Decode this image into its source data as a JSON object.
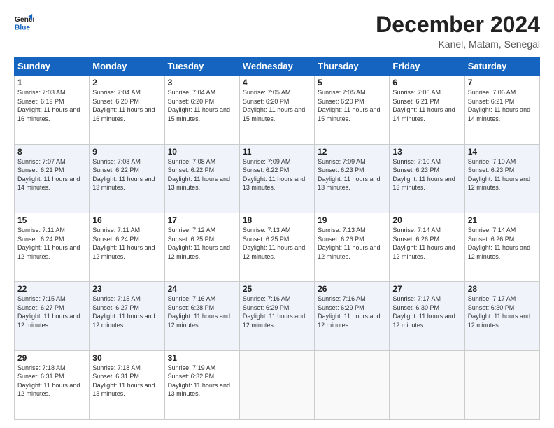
{
  "logo": {
    "line1": "General",
    "line2": "Blue"
  },
  "header": {
    "month_year": "December 2024",
    "location": "Kanel, Matam, Senegal"
  },
  "days_of_week": [
    "Sunday",
    "Monday",
    "Tuesday",
    "Wednesday",
    "Thursday",
    "Friday",
    "Saturday"
  ],
  "weeks": [
    [
      {
        "day": 1,
        "sunrise": "7:03 AM",
        "sunset": "6:19 PM",
        "daylight": "11 hours and 16 minutes."
      },
      {
        "day": 2,
        "sunrise": "7:04 AM",
        "sunset": "6:20 PM",
        "daylight": "11 hours and 16 minutes."
      },
      {
        "day": 3,
        "sunrise": "7:04 AM",
        "sunset": "6:20 PM",
        "daylight": "11 hours and 15 minutes."
      },
      {
        "day": 4,
        "sunrise": "7:05 AM",
        "sunset": "6:20 PM",
        "daylight": "11 hours and 15 minutes."
      },
      {
        "day": 5,
        "sunrise": "7:05 AM",
        "sunset": "6:20 PM",
        "daylight": "11 hours and 15 minutes."
      },
      {
        "day": 6,
        "sunrise": "7:06 AM",
        "sunset": "6:21 PM",
        "daylight": "11 hours and 14 minutes."
      },
      {
        "day": 7,
        "sunrise": "7:06 AM",
        "sunset": "6:21 PM",
        "daylight": "11 hours and 14 minutes."
      }
    ],
    [
      {
        "day": 8,
        "sunrise": "7:07 AM",
        "sunset": "6:21 PM",
        "daylight": "11 hours and 14 minutes."
      },
      {
        "day": 9,
        "sunrise": "7:08 AM",
        "sunset": "6:22 PM",
        "daylight": "11 hours and 13 minutes."
      },
      {
        "day": 10,
        "sunrise": "7:08 AM",
        "sunset": "6:22 PM",
        "daylight": "11 hours and 13 minutes."
      },
      {
        "day": 11,
        "sunrise": "7:09 AM",
        "sunset": "6:22 PM",
        "daylight": "11 hours and 13 minutes."
      },
      {
        "day": 12,
        "sunrise": "7:09 AM",
        "sunset": "6:23 PM",
        "daylight": "11 hours and 13 minutes."
      },
      {
        "day": 13,
        "sunrise": "7:10 AM",
        "sunset": "6:23 PM",
        "daylight": "11 hours and 13 minutes."
      },
      {
        "day": 14,
        "sunrise": "7:10 AM",
        "sunset": "6:23 PM",
        "daylight": "11 hours and 12 minutes."
      }
    ],
    [
      {
        "day": 15,
        "sunrise": "7:11 AM",
        "sunset": "6:24 PM",
        "daylight": "11 hours and 12 minutes."
      },
      {
        "day": 16,
        "sunrise": "7:11 AM",
        "sunset": "6:24 PM",
        "daylight": "11 hours and 12 minutes."
      },
      {
        "day": 17,
        "sunrise": "7:12 AM",
        "sunset": "6:25 PM",
        "daylight": "11 hours and 12 minutes."
      },
      {
        "day": 18,
        "sunrise": "7:13 AM",
        "sunset": "6:25 PM",
        "daylight": "11 hours and 12 minutes."
      },
      {
        "day": 19,
        "sunrise": "7:13 AM",
        "sunset": "6:26 PM",
        "daylight": "11 hours and 12 minutes."
      },
      {
        "day": 20,
        "sunrise": "7:14 AM",
        "sunset": "6:26 PM",
        "daylight": "11 hours and 12 minutes."
      },
      {
        "day": 21,
        "sunrise": "7:14 AM",
        "sunset": "6:26 PM",
        "daylight": "11 hours and 12 minutes."
      }
    ],
    [
      {
        "day": 22,
        "sunrise": "7:15 AM",
        "sunset": "6:27 PM",
        "daylight": "11 hours and 12 minutes."
      },
      {
        "day": 23,
        "sunrise": "7:15 AM",
        "sunset": "6:27 PM",
        "daylight": "11 hours and 12 minutes."
      },
      {
        "day": 24,
        "sunrise": "7:16 AM",
        "sunset": "6:28 PM",
        "daylight": "11 hours and 12 minutes."
      },
      {
        "day": 25,
        "sunrise": "7:16 AM",
        "sunset": "6:29 PM",
        "daylight": "11 hours and 12 minutes."
      },
      {
        "day": 26,
        "sunrise": "7:16 AM",
        "sunset": "6:29 PM",
        "daylight": "11 hours and 12 minutes."
      },
      {
        "day": 27,
        "sunrise": "7:17 AM",
        "sunset": "6:30 PM",
        "daylight": "11 hours and 12 minutes."
      },
      {
        "day": 28,
        "sunrise": "7:17 AM",
        "sunset": "6:30 PM",
        "daylight": "11 hours and 12 minutes."
      }
    ],
    [
      {
        "day": 29,
        "sunrise": "7:18 AM",
        "sunset": "6:31 PM",
        "daylight": "11 hours and 12 minutes."
      },
      {
        "day": 30,
        "sunrise": "7:18 AM",
        "sunset": "6:31 PM",
        "daylight": "11 hours and 13 minutes."
      },
      {
        "day": 31,
        "sunrise": "7:19 AM",
        "sunset": "6:32 PM",
        "daylight": "11 hours and 13 minutes."
      },
      null,
      null,
      null,
      null
    ]
  ]
}
